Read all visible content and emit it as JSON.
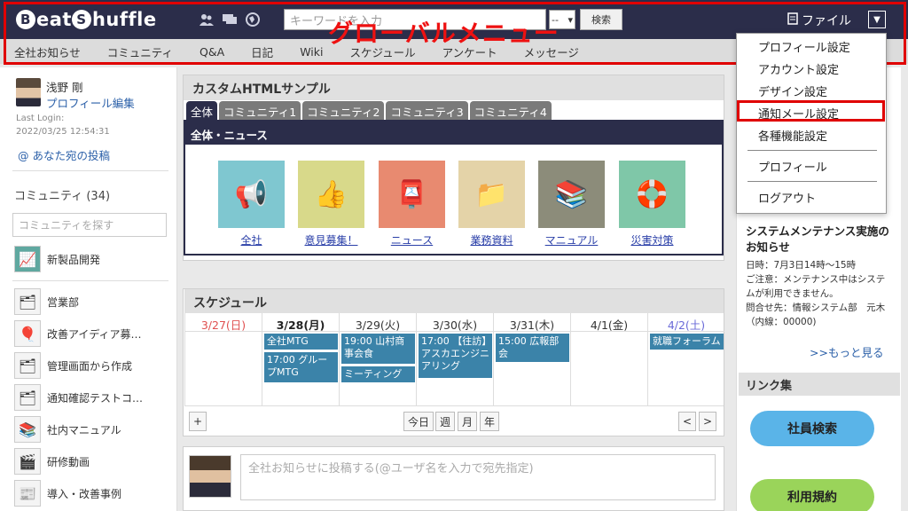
{
  "header": {
    "logo_prefix": "B",
    "logo_mid": "eat ",
    "logo_badge2": "S",
    "logo_suffix": "huffle",
    "search_placeholder": "キーワードを入力",
    "search_select": "--",
    "search_button": "検索",
    "file_label": "ファイル",
    "icons": [
      "users-icon",
      "chat-icon",
      "globe-icon",
      "file-icon",
      "chevron-down-icon"
    ]
  },
  "global_nav": {
    "items": [
      "全社お知らせ",
      "コミュニティ",
      "Q&A",
      "日記",
      "Wiki",
      "スケジュール",
      "アンケート",
      "メッセージ"
    ],
    "annotation": "グローバルメニュー",
    "annotation_color": "#e00000"
  },
  "user": {
    "name": "浅野 剛",
    "profile_edit": "プロフィール編集",
    "last_login_label": "Last Login:",
    "last_login": "2022/03/25 12:54:31",
    "mentions": "@ あなた宛の投稿"
  },
  "community": {
    "heading": "コミュニティ (34)",
    "search_placeholder": "コミュニティを探す",
    "items": [
      "新製品開発",
      "営業部",
      "改善アイディア募…",
      "管理画面から作成",
      "通知確認テストコ…",
      "社内マニュアル",
      "研修動画",
      "導入・改善事例"
    ]
  },
  "custom_html": {
    "title": "カスタムHTMLサンプル",
    "tabs": [
      "全体",
      "コミュニティ1",
      "コミュニティ2",
      "コミュニティ3",
      "コミュニティ4"
    ],
    "news_heading": "全体・ニュース",
    "tiles": [
      {
        "label": "全社",
        "color": "#7fc7d0",
        "icon": "megaphone-icon"
      },
      {
        "label": "意見募集！",
        "color": "#d8d98a",
        "icon": "thumbs-up-icon"
      },
      {
        "label": "ニュース",
        "color": "#e88a70",
        "icon": "postbox-icon"
      },
      {
        "label": "業務資料",
        "color": "#e4d3a8",
        "icon": "folder-icon"
      },
      {
        "label": "マニュアル",
        "color": "#8c8c7a",
        "icon": "binders-icon"
      },
      {
        "label": "災害対策",
        "color": "#7fc7a8",
        "icon": "lifebuoy-icon"
      }
    ]
  },
  "schedule": {
    "title": "スケジュール",
    "days": [
      {
        "label": "3/27(日)",
        "color": "#e05050",
        "bold": false
      },
      {
        "label": "3/28(月)",
        "color": "#222222",
        "bold": true
      },
      {
        "label": "3/29(火)",
        "color": "#333333",
        "bold": false
      },
      {
        "label": "3/30(水)",
        "color": "#333333",
        "bold": false
      },
      {
        "label": "3/31(木)",
        "color": "#333333",
        "bold": false
      },
      {
        "label": "4/1(金)",
        "color": "#333333",
        "bold": false
      },
      {
        "label": "4/2(土)",
        "color": "#6a6ad8",
        "bold": false
      }
    ],
    "events": [
      "全社MTG",
      "17:00 グループMTG",
      "19:00 山村商事会食",
      "ミーティング",
      "17:00 【往訪】アスカエンジニアリング",
      "15:00 広報部会",
      "就職フォーラム"
    ],
    "add_button": "+",
    "today": "今日",
    "week": "週",
    "month": "月",
    "year": "年",
    "prev": "<",
    "next": ">"
  },
  "post": {
    "placeholder": "全社お知らせに投稿する(@ユーザ名を入力で宛先指定)"
  },
  "notice": {
    "title": "システムメンテナンス実施のお知らせ",
    "line1": "日時：7月3日14時～15時",
    "line2": "ご注意：メンテナンス中はシステムが利用できません。",
    "line3": "問合せ先：情報システム部　元木（内線：00000)",
    "more": ">>もっと見る"
  },
  "links": {
    "heading": "リンク集",
    "employee_search": "社員検索",
    "terms": "利用規約",
    "employee_color": "#5ab4e8",
    "terms_color": "#9ad45a"
  },
  "menu": {
    "profile_settings": "プロフィール設定",
    "account_settings": "アカウント設定",
    "design_settings": "デザイン設定",
    "notify_mail": "通知メール設定",
    "features": "各種機能設定",
    "profile": "プロフィール",
    "logout": "ログアウト"
  }
}
